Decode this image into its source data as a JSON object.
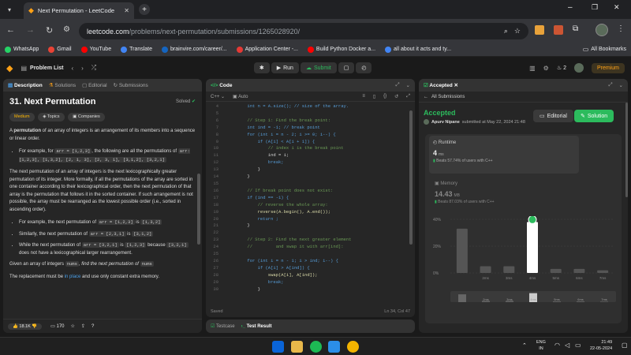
{
  "browser": {
    "tab_title": "Next Permutation - LeetCode",
    "url_domain": "leetcode.com",
    "url_path": "/problems/next-permutation/submissions/1265028920/"
  },
  "bookmarks": [
    {
      "label": "WhatsApp",
      "color": "#25d366"
    },
    {
      "label": "Gmail",
      "color": "#ea4335"
    },
    {
      "label": "YouTube",
      "color": "#ff0000"
    },
    {
      "label": "Translate",
      "color": "#4285f4"
    },
    {
      "label": "brainvire.com/career/...",
      "color": "#1565c0"
    },
    {
      "label": "Application Center -...",
      "color": "#e53935"
    },
    {
      "label": "Build Python Docker a...",
      "color": "#ff0000"
    },
    {
      "label": "all about it acts and ty...",
      "color": "#4285f4"
    }
  ],
  "all_bookmarks": "All Bookmarks",
  "nav": {
    "problem_list": "Problem List",
    "run": "Run",
    "submit": "Submit",
    "streak": "2",
    "premium": "Premium"
  },
  "left": {
    "tabs": [
      "Description",
      "Solutions",
      "Editorial",
      "Submissions"
    ],
    "title": "31. Next Permutation",
    "solved": "Solved",
    "tags": [
      "Medium",
      "Topics",
      "Companies"
    ],
    "p1a": "A ",
    "p1b": "permutation",
    "p1c": " of an array of integers is an arrangement of its members into a sequence or linear order.",
    "b1a": "For example, for ",
    "b1code": "arr = [1,2,3]",
    "b1b": ", the following are all the permutations of ",
    "b1code2": "arr: [1,2,3], [1,3,2], [2, 1, 3], [2, 3, 1], [3,1,2], [3,2,1]",
    "p2": "The next permutation of an array of integers is the next lexicographically greater permutation of its integer. More formally, if all the permutations of the array are sorted in one container according to their lexicographical order, then the next permutation of that array is the permutation that follows it in the sorted container. If such arrangement is not possible, the array must be rearranged as the lowest possible order (i.e., sorted in ascending order).",
    "e1a": "For example, the next permutation of ",
    "e1c": "arr = [1,2,3]",
    "e1b": " is ",
    "e1d": "[1,3,2]",
    "e2a": "Similarly, the next permutation of ",
    "e2c": "arr = [2,3,1]",
    "e2b": " is ",
    "e2d": "[3,1,2]",
    "e3a": "While the next permutation of ",
    "e3c": "arr = [3,2,1]",
    "e3b": " is ",
    "e3d": "[1,2,3]",
    "e3e": " because ",
    "e3f": "[3,2,1]",
    "e3g": " does not have a lexicographical larger rearrangement.",
    "p3a": "Given an array of integers ",
    "p3c": "nums",
    "p3b": ", find the next permutation of ",
    "p3d": "nums",
    "p4a": "The replacement must be ",
    "p4b": "in place",
    "p4c": " and use only constant extra memory.",
    "likes": "18.1K",
    "comments": "170"
  },
  "editor": {
    "tab": "Code",
    "lang": "C++",
    "mode": "Auto",
    "status": "Saved",
    "cursor": "Ln 34, Col 47",
    "lines": [
      {
        "n": "4",
        "t": "        int n = A.size(); // size of the array."
      },
      {
        "n": "5",
        "t": ""
      },
      {
        "n": "6",
        "t": "        // Step 1: Find the break point:"
      },
      {
        "n": "7",
        "t": "        int ind = -1; // break point"
      },
      {
        "n": "8",
        "t": "        for (int i = n - 2; i >= 0; i--) {"
      },
      {
        "n": "9",
        "t": "            if (A[i] < A[i + 1]) {"
      },
      {
        "n": "10",
        "t": "                // index i is the break point"
      },
      {
        "n": "11",
        "t": "                ind = i;"
      },
      {
        "n": "12",
        "t": "                break;"
      },
      {
        "n": "13",
        "t": "            }"
      },
      {
        "n": "14",
        "t": "        }"
      },
      {
        "n": "15",
        "t": ""
      },
      {
        "n": "16",
        "t": "        // If break point does not exist:"
      },
      {
        "n": "17",
        "t": "        if (ind == -1) {"
      },
      {
        "n": "18",
        "t": "            // reverse the whole array:"
      },
      {
        "n": "19",
        "t": "            reverse(A.begin(), A.end());"
      },
      {
        "n": "20",
        "t": "            return ;"
      },
      {
        "n": "21",
        "t": "        }"
      },
      {
        "n": "22",
        "t": ""
      },
      {
        "n": "23",
        "t": "        // Step 2: Find the next greater element"
      },
      {
        "n": "24",
        "t": "        //         and swap it with arr[ind]:"
      },
      {
        "n": "25",
        "t": ""
      },
      {
        "n": "26",
        "t": "        for (int i = n - 1; i > ind; i--) {"
      },
      {
        "n": "27",
        "t": "            if (A[i] > A[ind]) {"
      },
      {
        "n": "28",
        "t": "                swap(A[i], A[ind]);"
      },
      {
        "n": "29",
        "t": "                break;"
      },
      {
        "n": "30",
        "t": "            }"
      }
    ]
  },
  "bottom": {
    "testcase": "Testcase",
    "result": "Test Result"
  },
  "right": {
    "tab": "Accepted",
    "back": "All Submissions",
    "status": "Accepted",
    "user": "Apurv Nipane",
    "submitted": "submitted at May 22, 2024 21:48",
    "editorial": "Editorial",
    "solution": "Solution",
    "runtime_label": "Runtime",
    "runtime_val": "4",
    "runtime_unit": "ms",
    "runtime_beats": "Beats 57.74% of users with C++",
    "memory_label": "Memory",
    "memory_val": "14.43",
    "memory_unit": "MB",
    "memory_beats": "Beats 87.03% of users with C++",
    "y_ticks": [
      "40%",
      "20%",
      "0%"
    ]
  },
  "chart_data": {
    "type": "bar",
    "categories": [
      "",
      "2ms",
      "3ms",
      "4ms",
      "5ms",
      "6ms",
      "7ms"
    ],
    "values": [
      33,
      5,
      5,
      38,
      3,
      3,
      2
    ],
    "ylim": [
      0,
      40
    ],
    "highlight": "4ms"
  },
  "taskbar": {
    "lang1": "ENG",
    "lang2": "IN",
    "time": "21:49",
    "date": "22-05-2024"
  }
}
